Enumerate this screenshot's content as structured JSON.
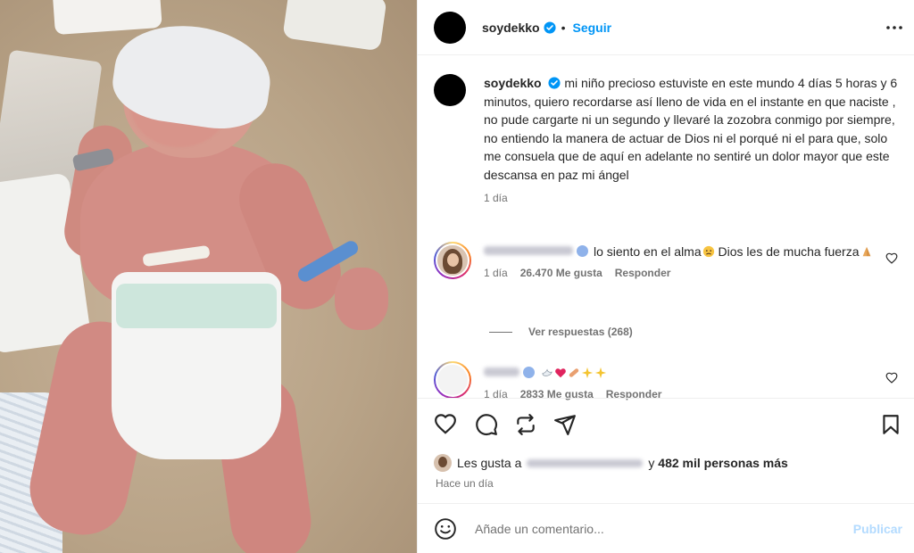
{
  "post": {
    "username": "soydekko",
    "follow_label": "Seguir",
    "header_separator": "•"
  },
  "caption": {
    "username": "soydekko",
    "text": "mi niño precioso estuviste en este mundo 4 días 5 horas y 6 minutos, quiero recordarse así lleno de vida en el instante en que naciste , no pude cargarte ni un segundo y llevaré la zozobra conmigo por siempre, no entiendo la manera de actuar de Dios ni el porqué ni el para que, solo me consuela que de aquí en adelante no sentiré un dolor mayor que este descansa en paz mi ángel",
    "time": "1 día"
  },
  "comments": [
    {
      "text": "lo siento en el alma",
      "text_after": " Dios les de mucha fuerza",
      "time": "1 día",
      "likes": "26.470 Me gusta",
      "reply_label": "Responder",
      "view_replies": "Ver respuestas (268)",
      "emojis": [
        "sad-face",
        "folded-hands"
      ]
    },
    {
      "text": "",
      "emojis": [
        "dove",
        "red-heart",
        "bandage",
        "sparkles",
        "sparkles"
      ],
      "time": "1 día",
      "likes": "2833 Me gusta",
      "reply_label": "Responder"
    }
  ],
  "likes_summary": {
    "prefix": "Les gusta a",
    "suffix_connector": "y",
    "count_text": "482 mil personas más"
  },
  "time_ago": "Hace un día",
  "comment_box": {
    "placeholder": "Añade un comentario...",
    "publish_label": "Publicar"
  },
  "colors": {
    "accent": "#0095f6",
    "publish_disabled": "#b3dbff",
    "muted": "#737373",
    "heart_red": "#e0245e"
  }
}
